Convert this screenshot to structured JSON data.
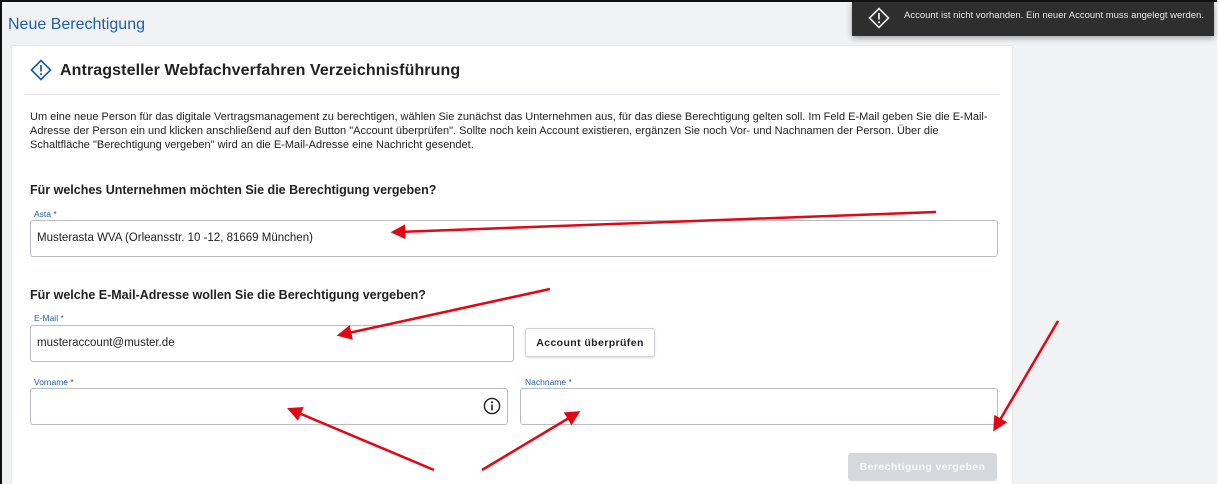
{
  "page": {
    "title": "Neue Berechtigung"
  },
  "toast": {
    "message": "Account ist nicht vorhanden. Ein neuer Account muss angelegt werden.",
    "icon": "diamond-info-icon"
  },
  "card": {
    "title": "Antragsteller Webfachverfahren Verzeichnisführung",
    "icon": "diamond-info-icon",
    "intro": "Um eine neue Person für das digitale Vertragsmanagement zu berechtigen, wählen Sie zunächst das Unternehmen aus, für das diese Berechtigung gelten soll. Im Feld E-Mail geben Sie die E-Mail-Adresse der Person ein und klicken anschließend auf den Button \"Account überprüfen\". Sollte noch kein Account existieren, ergänzen Sie noch Vor- und Nachnamen der Person. Über die Schaltfläche \"Berechtigung vergeben\" wird an die E-Mail-Adresse eine Nachricht gesendet."
  },
  "company_section": {
    "heading": "Für welches Unternehmen möchten Sie die Berechtigung vergeben?",
    "asta_label": "Asta *",
    "asta_value": "Musterasta WVA (Orleansstr. 10 -12, 81669 München)"
  },
  "email_section": {
    "heading": "Für welche E-Mail-Adresse wollen Sie die Berechtigung vergeben?",
    "email_label": "E-Mail *",
    "email_value": "musteraccount@muster.de",
    "check_button": "Account überprüfen",
    "firstname_label": "Vorname *",
    "firstname_value": "",
    "lastname_label": "Nachname *",
    "lastname_value": "",
    "submit_button": "Berechtigung vergeben"
  },
  "colors": {
    "accent": "#1f5fa8",
    "annotation_arrow": "#e30613",
    "toast_bg": "#2e2e2e",
    "disabled_button": "#d6d8db"
  }
}
